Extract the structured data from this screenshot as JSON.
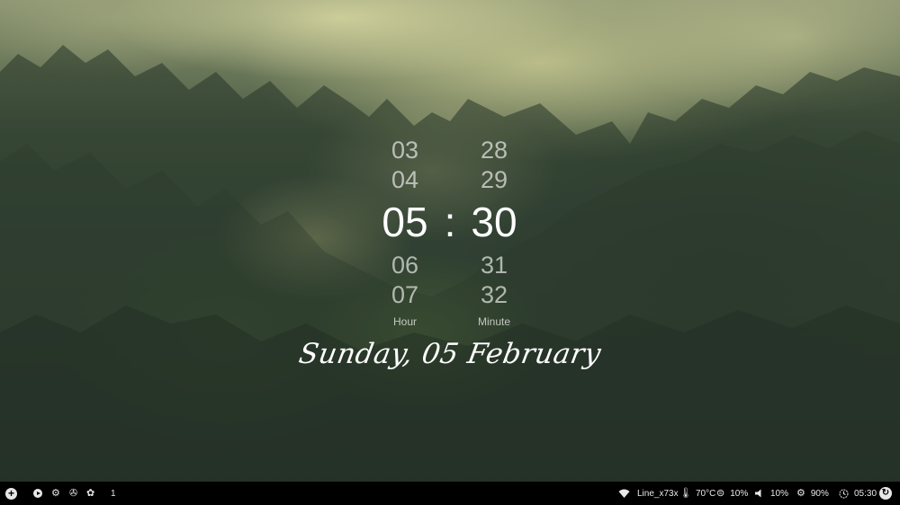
{
  "clock": {
    "hours": {
      "prev2": "03",
      "prev1": "04",
      "current": "05",
      "next1": "06",
      "next2": "07",
      "label": "Hour"
    },
    "separator": ":",
    "minutes": {
      "prev2": "28",
      "prev1": "29",
      "current": "30",
      "next1": "31",
      "next2": "32",
      "label": "Minute"
    },
    "date": "Sunday, 05 February"
  },
  "taskbar": {
    "left": {
      "launcher_icon": "plus-circle-icon",
      "play_icon": "play-circle-icon",
      "settings_icon": "gear-icon",
      "aperture_icon": "aperture-icon",
      "palette_icon": "palette-icon",
      "workspace": "1"
    },
    "right": {
      "wifi": {
        "icon": "wifi-icon",
        "label": "Line_x73x"
      },
      "temperature": {
        "icon": "thermometer-icon",
        "label": "70°C"
      },
      "cpu": {
        "icon": "cpu-icon",
        "label": "10%"
      },
      "volume": {
        "icon": "volume-icon",
        "label": "10%"
      },
      "brightness": {
        "icon": "brightness-icon",
        "label": "90%"
      },
      "time": {
        "icon": "clock-icon",
        "label": "05:30"
      },
      "power_icon": "power-icon"
    }
  },
  "colors": {
    "taskbar_bg": "#000000",
    "text_primary": "#ffffff",
    "text_dim": "rgba(255,255,255,0.62)"
  }
}
